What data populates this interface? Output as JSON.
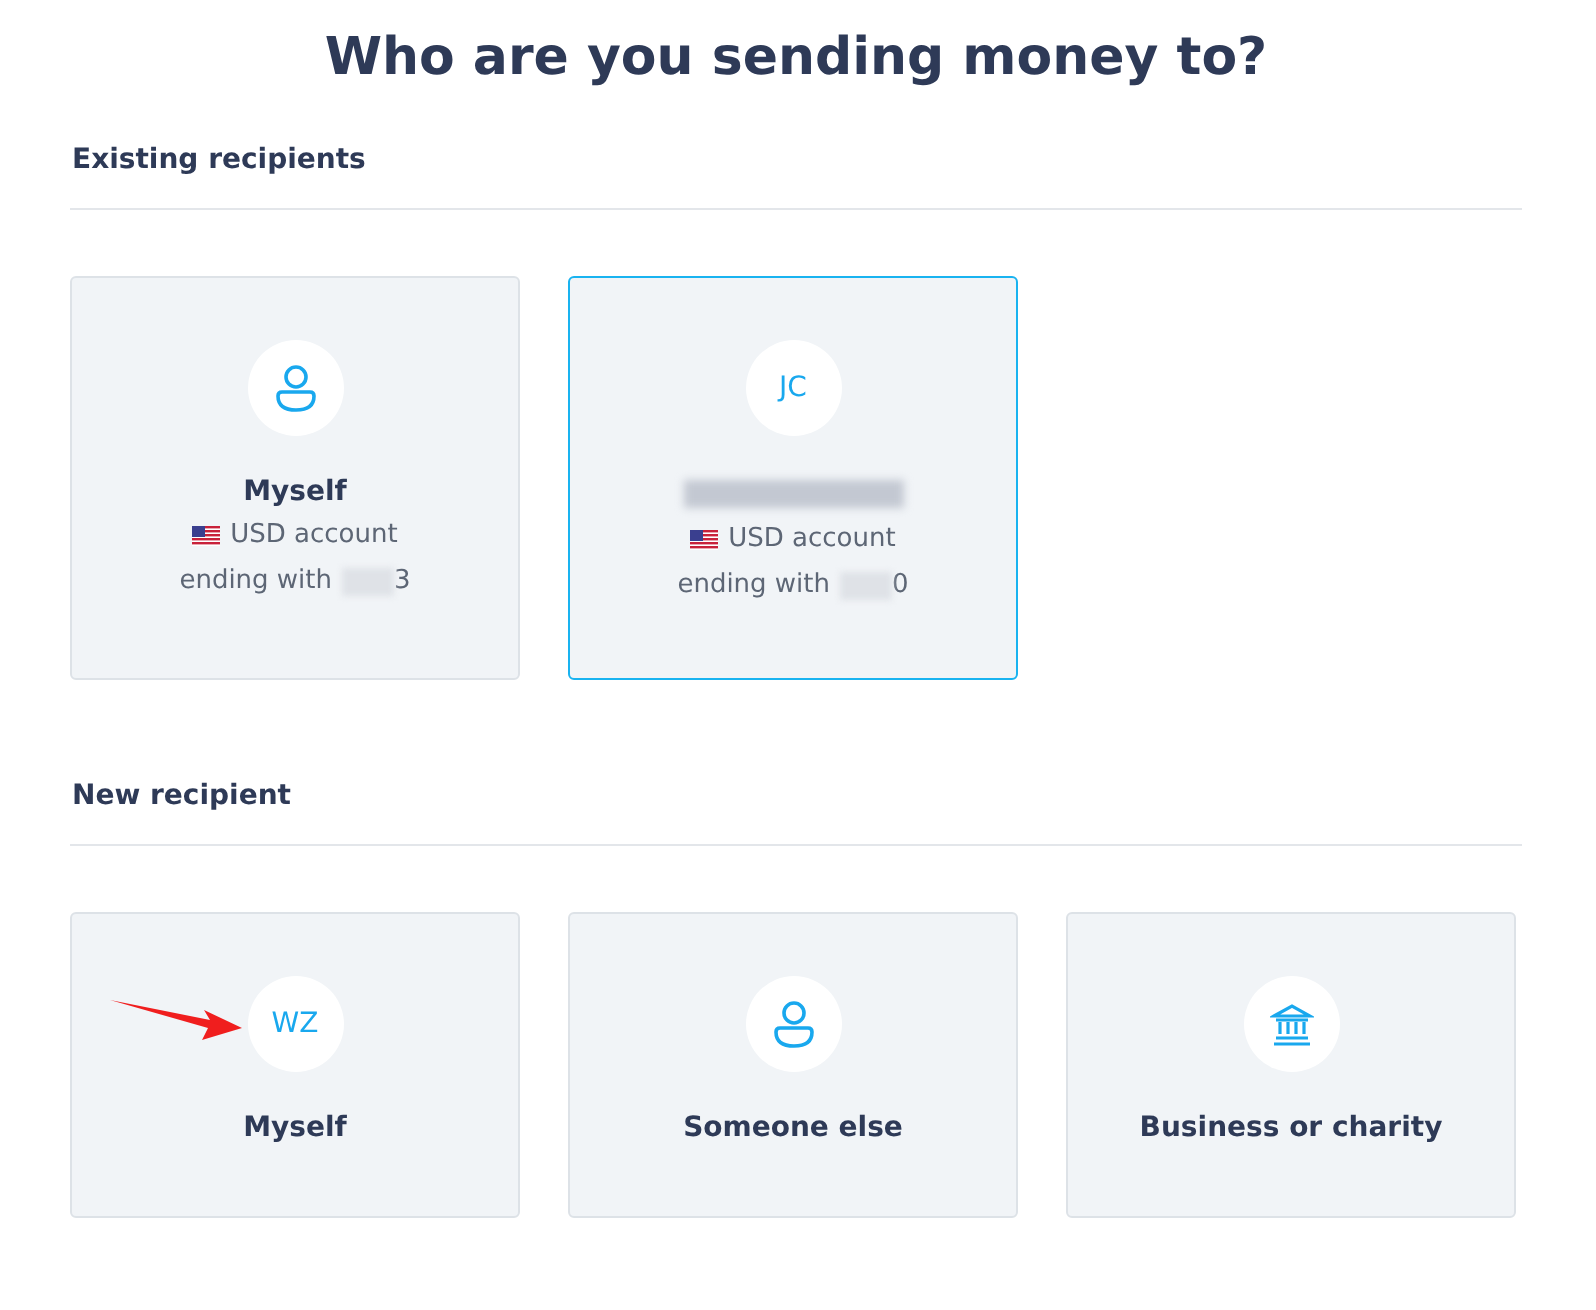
{
  "title": "Who are you sending money to?",
  "sections": [
    {
      "heading": "Existing recipients",
      "cards": [
        {
          "avatar": {
            "kind": "person"
          },
          "name": "Myself",
          "name_redacted": false,
          "account": "USD account",
          "ending": "ending with",
          "ending_tail": "3",
          "selected": false
        },
        {
          "avatar": {
            "kind": "initials",
            "text": "JC"
          },
          "name_redacted": true,
          "account": "USD account",
          "ending": "ending with",
          "ending_tail": "0",
          "selected": true
        }
      ]
    },
    {
      "heading": "New recipient",
      "cards": [
        {
          "avatar": {
            "kind": "initials",
            "text": "WZ"
          },
          "name": "Myself",
          "name_redacted": false,
          "selected": false,
          "pointer": true
        },
        {
          "avatar": {
            "kind": "person"
          },
          "name": "Someone else",
          "name_redacted": false,
          "selected": false
        },
        {
          "avatar": {
            "kind": "bank"
          },
          "name": "Business or charity",
          "name_redacted": false,
          "selected": false
        }
      ]
    }
  ]
}
